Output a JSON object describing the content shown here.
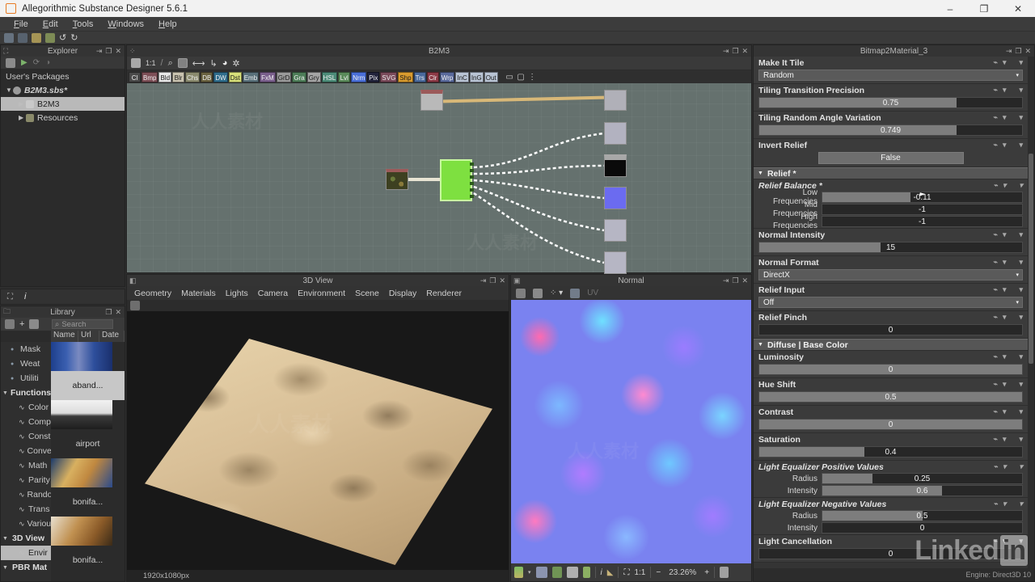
{
  "window": {
    "title": "Allegorithmic Substance Designer 5.6.1",
    "minimize": "–",
    "maximize": "❐",
    "close": "✕"
  },
  "menu": {
    "items": [
      "File",
      "Edit",
      "Tools",
      "Windows",
      "Help"
    ]
  },
  "explorer": {
    "title": "Explorer",
    "root_label": "User's Packages",
    "items": [
      {
        "label": "B2M3.sbs*",
        "arrow": "▼",
        "selected": false,
        "indent": 0
      },
      {
        "label": "B2M3",
        "arrow": "▶",
        "selected": true,
        "indent": 1
      },
      {
        "label": "Resources",
        "arrow": "▶",
        "selected": false,
        "indent": 1
      }
    ]
  },
  "library": {
    "title": "Library",
    "search_placeholder": "Search",
    "columns": [
      "Name",
      "Url",
      "Date"
    ],
    "tree": [
      {
        "label": "Mask",
        "indent": 1,
        "group": false,
        "selected": false
      },
      {
        "label": "Weat",
        "indent": 1,
        "group": false,
        "selected": false
      },
      {
        "label": "Utiliti",
        "indent": 1,
        "group": false,
        "selected": false
      },
      {
        "label": "Functions",
        "indent": 0,
        "group": true,
        "selected": false
      },
      {
        "label": "Color",
        "indent": 2,
        "group": false,
        "selected": false
      },
      {
        "label": "Comp",
        "indent": 2,
        "group": false,
        "selected": false
      },
      {
        "label": "Const",
        "indent": 2,
        "group": false,
        "selected": false
      },
      {
        "label": "Conve",
        "indent": 2,
        "group": false,
        "selected": false
      },
      {
        "label": "Math",
        "indent": 2,
        "group": false,
        "selected": false
      },
      {
        "label": "Parity",
        "indent": 2,
        "group": false,
        "selected": false
      },
      {
        "label": "Rando",
        "indent": 2,
        "group": false,
        "selected": false
      },
      {
        "label": "Trans",
        "indent": 2,
        "group": false,
        "selected": false
      },
      {
        "label": "Variou",
        "indent": 2,
        "group": false,
        "selected": false
      },
      {
        "label": "3D View",
        "indent": 0,
        "group": true,
        "selected": false
      },
      {
        "label": "Envir",
        "indent": 2,
        "group": false,
        "selected": true
      },
      {
        "label": "PBR Mat",
        "indent": 0,
        "group": true,
        "selected": false
      }
    ],
    "results": [
      {
        "name": "aband...",
        "light": true
      },
      {
        "name": "airport",
        "light": false
      },
      {
        "name": "bonifa...",
        "light": false
      },
      {
        "name": "bonifa...",
        "light": false
      }
    ]
  },
  "graph": {
    "title": "B2M3",
    "node_buttons": [
      {
        "label": "Cl",
        "color": "#4a4a4a"
      },
      {
        "label": "Bmp",
        "color": "#7d4f57"
      },
      {
        "label": "Bld",
        "color": "#e8e8e8",
        "dark": true
      },
      {
        "label": "Blr",
        "color": "#c9c3b0",
        "dark": true
      },
      {
        "label": "Chs",
        "color": "#8a8a6e"
      },
      {
        "label": "DB",
        "color": "#6a6240"
      },
      {
        "label": "DW",
        "color": "#2f6d8c"
      },
      {
        "label": "Dst",
        "color": "#d8e07a",
        "dark": true
      },
      {
        "label": "Emb",
        "color": "#59707a"
      },
      {
        "label": "FxM",
        "color": "#7a5f8c"
      },
      {
        "label": "GrD",
        "color": "#9a9a9a",
        "dark": true
      },
      {
        "label": "Gra",
        "color": "#4d7d58"
      },
      {
        "label": "Gry",
        "color": "#a5a5a5",
        "dark": true
      },
      {
        "label": "HSL",
        "color": "#4c8c78"
      },
      {
        "label": "Lvl",
        "color": "#5a8a5a"
      },
      {
        "label": "Nrm",
        "color": "#4a6fd8"
      },
      {
        "label": "Pix",
        "color": "#22243c"
      },
      {
        "label": "SVG",
        "color": "#7a4a5a"
      },
      {
        "label": "Shp",
        "color": "#d99b2e",
        "dark": true
      },
      {
        "label": "Trs",
        "color": "#4a6a9c"
      },
      {
        "label": "Clr",
        "color": "#8c3a46"
      },
      {
        "label": "Wrp",
        "color": "#5a6a9c"
      },
      {
        "label": "InC",
        "color": "#b9c4d4",
        "dark": true
      },
      {
        "label": "InG",
        "color": "#b9c4d4",
        "dark": true
      },
      {
        "label": "Out",
        "color": "#b9c4d4",
        "dark": true
      }
    ],
    "zoom_label": "1:1"
  },
  "view3d": {
    "title": "3D View",
    "tabs": [
      "Geometry",
      "Materials",
      "Lights",
      "Camera",
      "Environment",
      "Scene",
      "Display",
      "Renderer"
    ],
    "resolution": "1920x1080px"
  },
  "view2d": {
    "title": "Normal",
    "uv_label": "UV",
    "ratio": "1:1",
    "zoom": "23.26%",
    "minus": "−",
    "plus": "+"
  },
  "properties": {
    "title": "Bitmap2Material_3",
    "engine": "Engine: Direct3D 10",
    "rows": [
      {
        "kind": "combo",
        "label": "Make It Tile",
        "value": "Random"
      },
      {
        "kind": "slider",
        "label": "Tiling Transition Precision",
        "value": "0.75",
        "fill": 75
      },
      {
        "kind": "slider",
        "label": "Tiling Random Angle Variation",
        "value": "0.749",
        "fill": 75
      },
      {
        "kind": "button",
        "label": "Invert Relief",
        "value": "False"
      },
      {
        "kind": "section",
        "label": "Relief *"
      },
      {
        "kind": "multi",
        "label": "Relief Balance *",
        "items": [
          {
            "label": "Low Frequencies",
            "value": "-0.11",
            "fill": 44
          },
          {
            "label": "Mid Frequencies",
            "value": "-1",
            "fill": 0
          },
          {
            "label": "High Frequencies",
            "value": "-1",
            "fill": 0
          }
        ]
      },
      {
        "kind": "slider",
        "label": "Normal Intensity",
        "value": "15",
        "fill": 46
      },
      {
        "kind": "combo",
        "label": "Normal Format",
        "value": "DirectX"
      },
      {
        "kind": "combo",
        "label": "Relief Input",
        "value": "Off"
      },
      {
        "kind": "slider",
        "label": "Relief Pinch",
        "value": "0",
        "fill": 0
      },
      {
        "kind": "section",
        "label": "Diffuse | Base Color"
      },
      {
        "kind": "slider",
        "label": "Luminosity",
        "value": "0",
        "fill": 100
      },
      {
        "kind": "slider",
        "label": "Hue Shift",
        "value": "0.5",
        "fill": 100
      },
      {
        "kind": "slider",
        "label": "Contrast",
        "value": "0",
        "fill": 100
      },
      {
        "kind": "slider",
        "label": "Saturation",
        "value": "0.4",
        "fill": 40
      },
      {
        "kind": "multi",
        "label": "Light Equalizer Positive Values",
        "items": [
          {
            "label": "Radius",
            "value": "0.25",
            "fill": 25
          },
          {
            "label": "Intensity",
            "value": "0.6",
            "fill": 60
          }
        ]
      },
      {
        "kind": "multi",
        "label": "Light Equalizer Negative Values",
        "items": [
          {
            "label": "Radius",
            "value": "0.5",
            "fill": 50
          },
          {
            "label": "Intensity",
            "value": "0",
            "fill": 0
          }
        ]
      },
      {
        "kind": "slider",
        "label": "Light Cancellation",
        "value": "0",
        "fill": 0
      }
    ]
  },
  "branding": {
    "linkedin_text": "Linked",
    "linkedin_badge": "in"
  }
}
